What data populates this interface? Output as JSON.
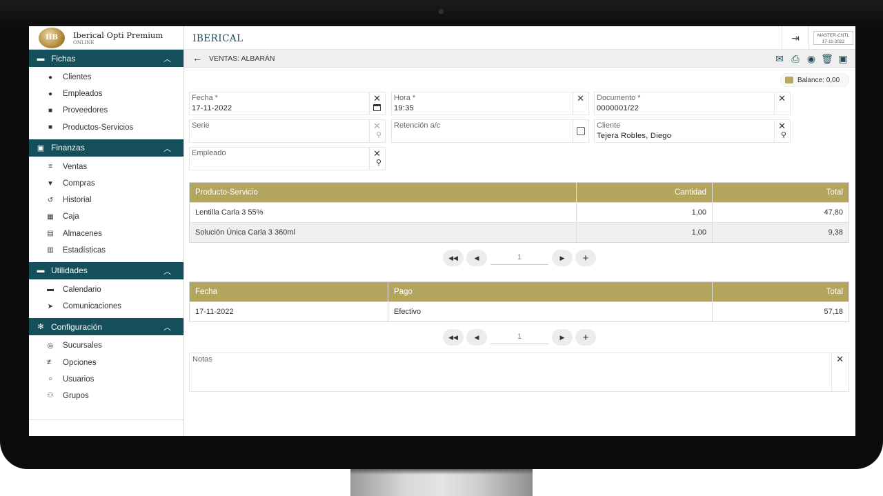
{
  "brand": {
    "title": "Iberical Opti Premium",
    "subtitle": "ONLINE",
    "logo_text": "IIB"
  },
  "topbar": {
    "app_name": "IBERICAL",
    "master_line1": "MASTER-CNTL",
    "master_line2": "17-11-2022"
  },
  "sidebar": {
    "sections": [
      {
        "label": "Fichas",
        "items": [
          "Clientes",
          "Empleados",
          "Proveedores",
          "Productos-Servicios"
        ]
      },
      {
        "label": "Finanzas",
        "items": [
          "Ventas",
          "Compras",
          "Historial",
          "Caja",
          "Almacenes",
          "Estadísticas"
        ]
      },
      {
        "label": "Utilidades",
        "items": [
          "Calendario",
          "Comunicaciones"
        ]
      },
      {
        "label": "Configuración",
        "items": [
          "Sucursales",
          "Opciones",
          "Usuarios",
          "Grupos"
        ]
      }
    ]
  },
  "page": {
    "title": "VENTAS: ALBARÁN",
    "balance": "Balance: 0,00"
  },
  "form": {
    "fecha": {
      "label": "Fecha *",
      "value": "17-11-2022"
    },
    "hora": {
      "label": "Hora *",
      "value": "19:35"
    },
    "documento": {
      "label": "Documento *",
      "value": "0000001/22"
    },
    "serie": {
      "label": "Serie",
      "value": ""
    },
    "retencion": {
      "label": "Retención a/c",
      "value": ""
    },
    "cliente": {
      "label": "Cliente",
      "value": "Tejera Robles, Diego"
    },
    "empleado": {
      "label": "Empleado",
      "value": ""
    }
  },
  "products": {
    "headers": [
      "Producto-Servicio",
      "Cantidad",
      "Total"
    ],
    "rows": [
      [
        "Lentilla Carla 3 55%",
        "1,00",
        "47,80"
      ],
      [
        "Solución Única Carla 3 360ml",
        "1,00",
        "9,38"
      ]
    ],
    "page": "1"
  },
  "payments": {
    "headers": [
      "Fecha",
      "Pago",
      "Total"
    ],
    "rows": [
      [
        "17-11-2022",
        "Efectivo",
        "57,18"
      ]
    ],
    "page": "1"
  },
  "notes": {
    "label": "Notas"
  }
}
